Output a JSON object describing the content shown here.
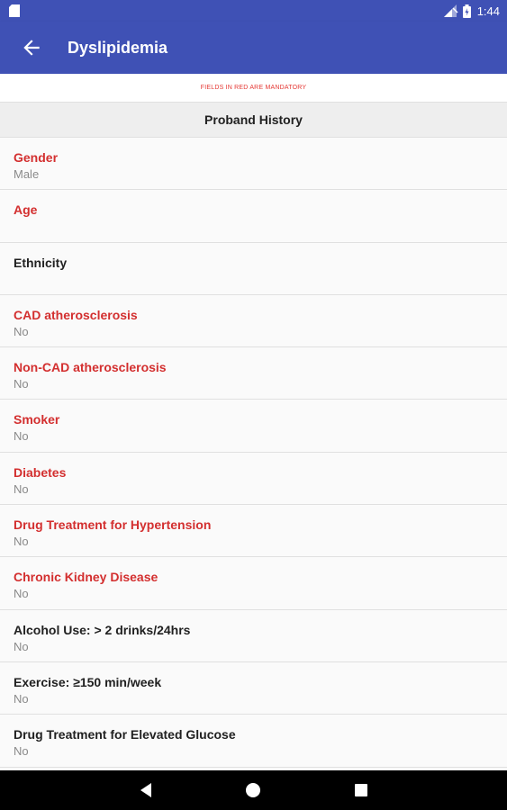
{
  "status": {
    "time": "1:44"
  },
  "toolbar": {
    "title": "Dyslipidemia"
  },
  "notice": "FIELDS IN RED ARE MANDATORY",
  "section": {
    "title": "Proband History"
  },
  "fields": [
    {
      "label": "Gender",
      "value": "Male",
      "mandatory": true
    },
    {
      "label": "Age",
      "value": "",
      "mandatory": true
    },
    {
      "label": "Ethnicity",
      "value": "",
      "mandatory": false
    },
    {
      "label": "CAD atherosclerosis",
      "value": "No",
      "mandatory": true
    },
    {
      "label": "Non-CAD atherosclerosis",
      "value": "No",
      "mandatory": true
    },
    {
      "label": "Smoker",
      "value": "No",
      "mandatory": true
    },
    {
      "label": "Diabetes",
      "value": "No",
      "mandatory": true
    },
    {
      "label": "Drug Treatment for Hypertension",
      "value": "No",
      "mandatory": true
    },
    {
      "label": "Chronic Kidney Disease",
      "value": "No",
      "mandatory": true
    },
    {
      "label": "Alcohol Use: > 2 drinks/24hrs",
      "value": "No",
      "mandatory": false
    },
    {
      "label": "Exercise: ≥150 min/week",
      "value": "No",
      "mandatory": false
    },
    {
      "label": "Drug Treatment for Elevated Glucose",
      "value": "No",
      "mandatory": false
    }
  ],
  "colors": {
    "primary": "#3f51b5",
    "mandatory": "#d32f2f",
    "normal": "#212121",
    "secondary": "#8a8a8a"
  },
  "icons": {
    "back": "arrow-back-icon",
    "status": [
      "sd-card-icon",
      "signal-icon",
      "battery-icon"
    ],
    "nav": [
      "back-triangle-icon",
      "home-circle-icon",
      "recents-square-icon"
    ]
  }
}
